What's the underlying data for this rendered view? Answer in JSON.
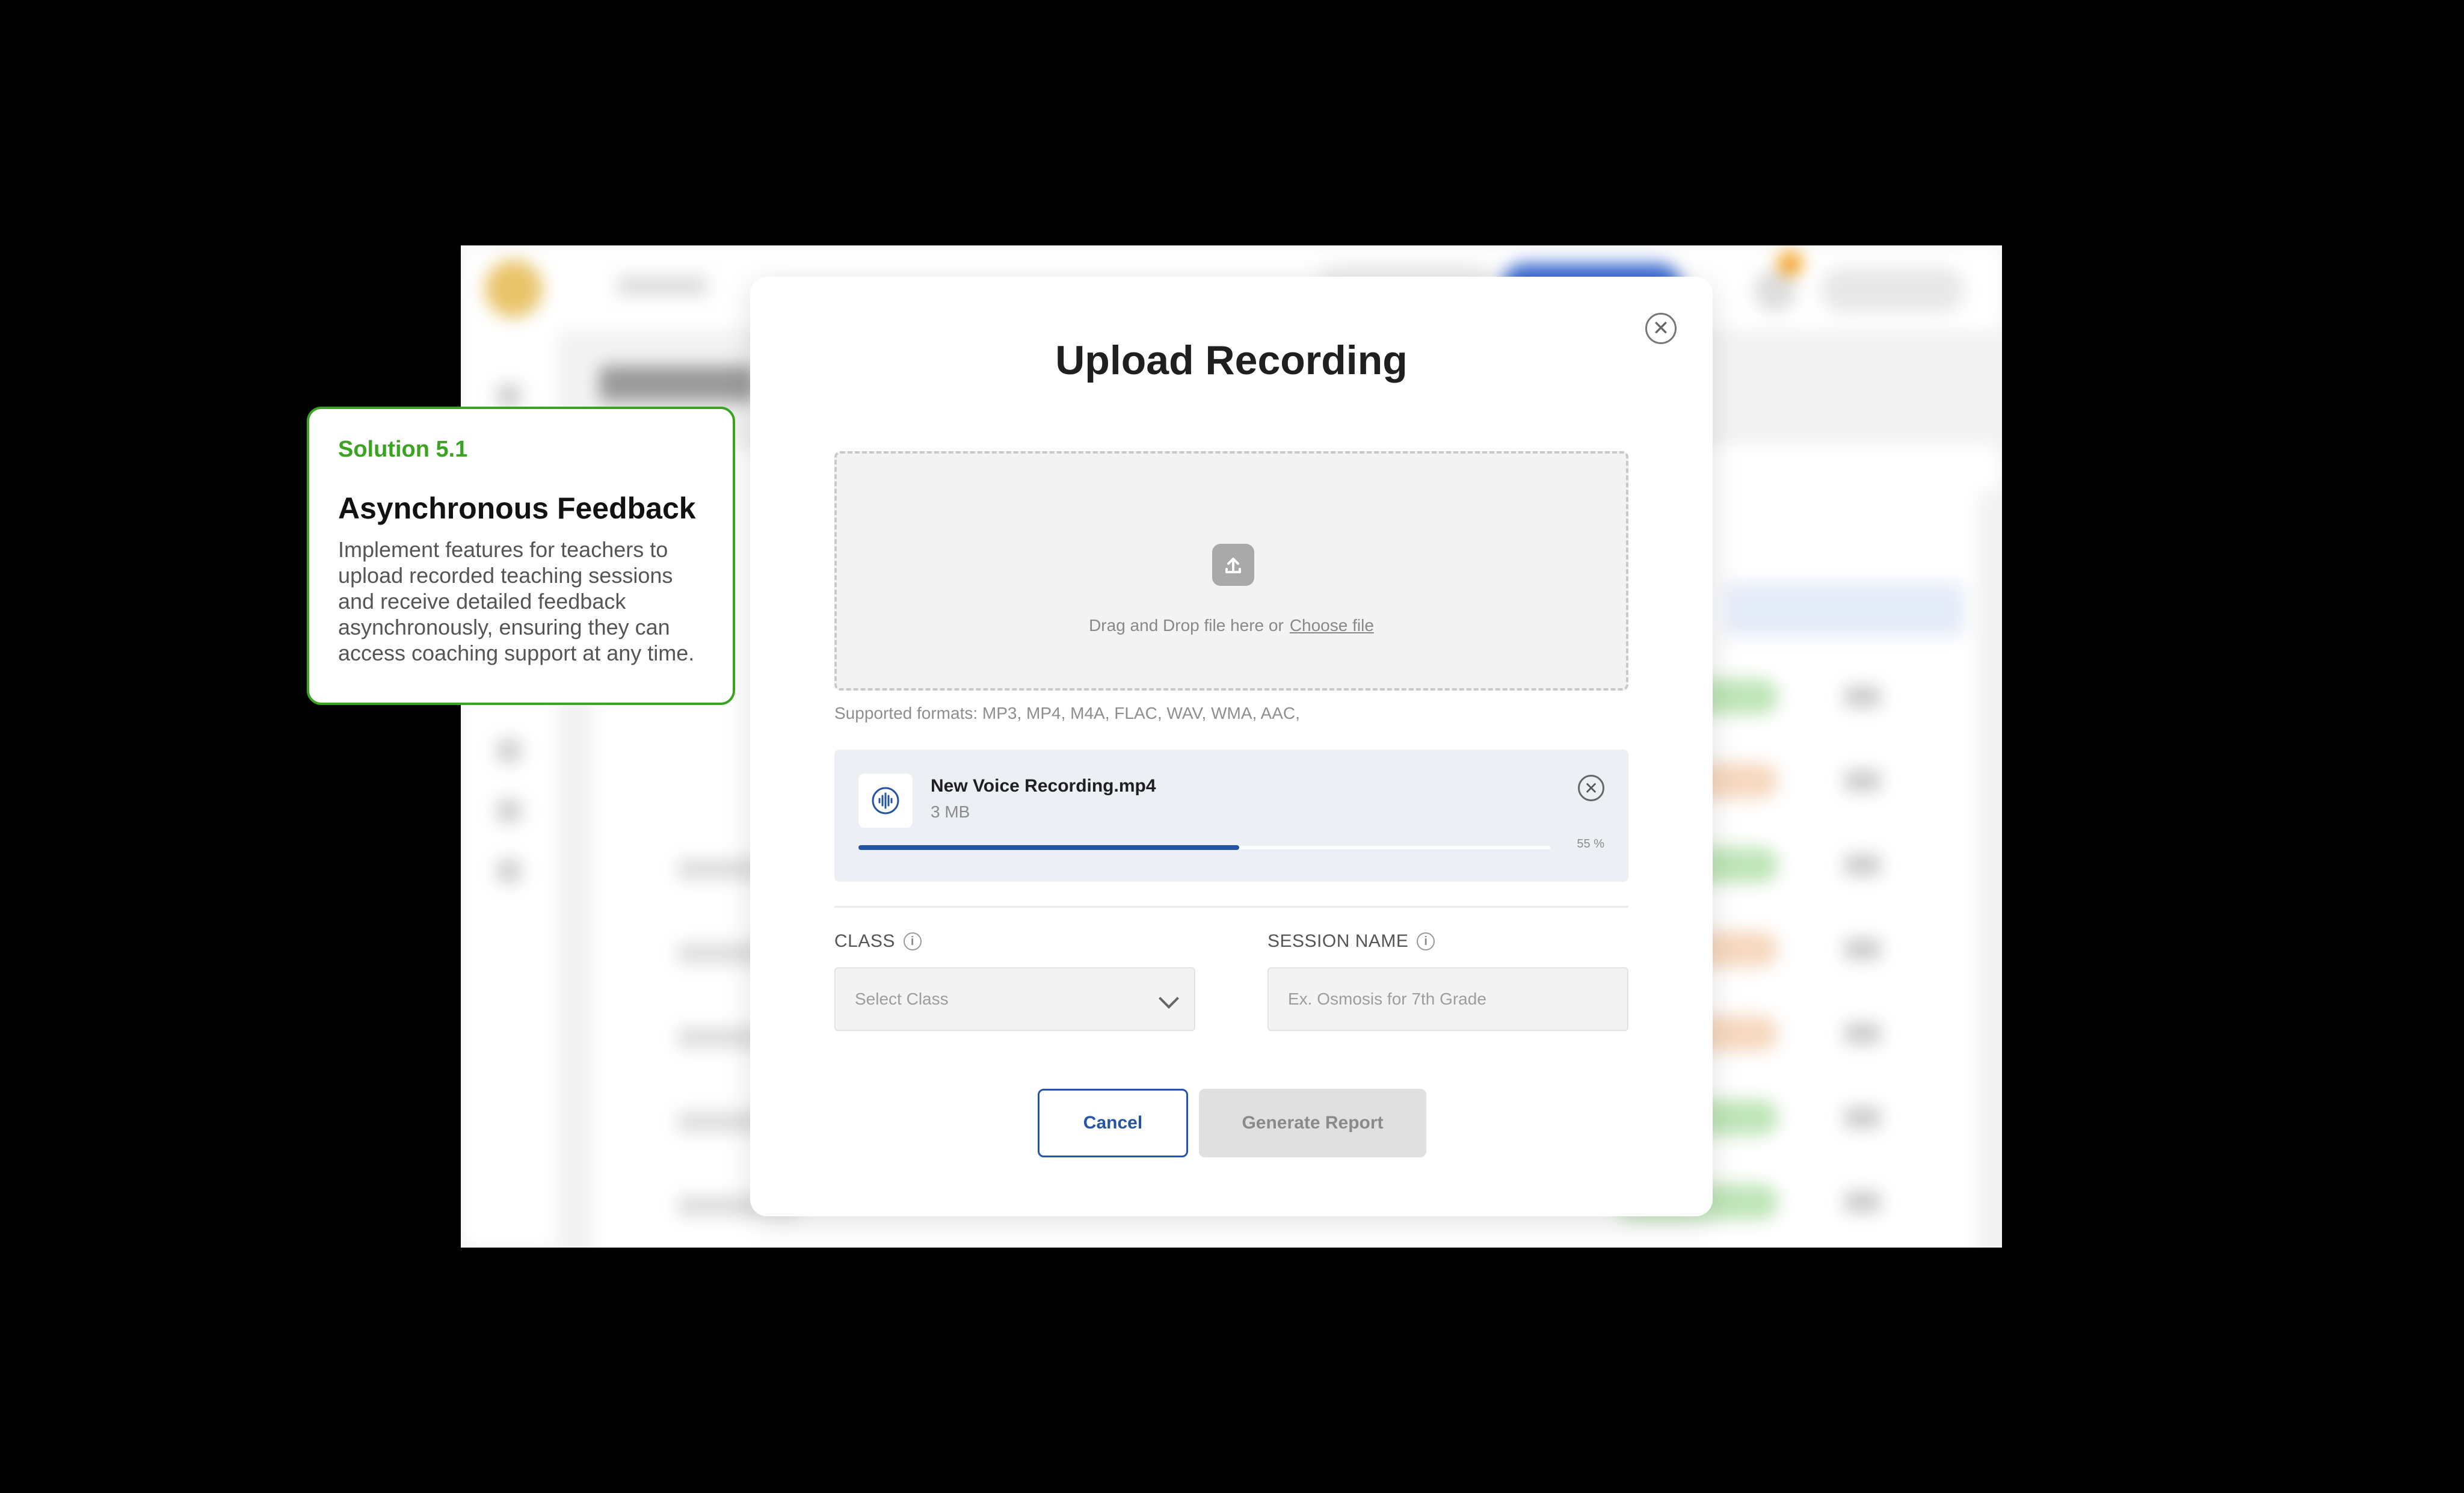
{
  "modal": {
    "title": "Upload Recording",
    "close_icon": "close-icon",
    "dropzone": {
      "icon": "upload-icon",
      "text": "Drag and Drop file here or",
      "link": "Choose file"
    },
    "supported_formats": "Supported formats: MP3, MP4, M4A, FLAC, WAV, WMA, AAC,",
    "file": {
      "icon": "audio-waveform-icon",
      "name": "New Voice Recording.mp4",
      "size": "3 MB",
      "progress_percent": 55,
      "progress_label": "55 %"
    },
    "class_field": {
      "label": "CLASS",
      "placeholder": "Select Class"
    },
    "session_field": {
      "label": "SESSION NAME",
      "placeholder": "Ex. Osmosis for 7th Grade"
    },
    "buttons": {
      "cancel": "Cancel",
      "generate": "Generate Report"
    }
  },
  "callout": {
    "tag": "Solution 5.1",
    "title": "Asynchronous Feedback",
    "body": "Implement features for teachers to upload recorded teaching sessions and receive detailed feedback asynchronously, ensuring they can access coaching support at any time."
  },
  "colors": {
    "primary": "#2454a6",
    "callout_accent": "#3aa321",
    "disabled_button": "#e0e0e0"
  }
}
